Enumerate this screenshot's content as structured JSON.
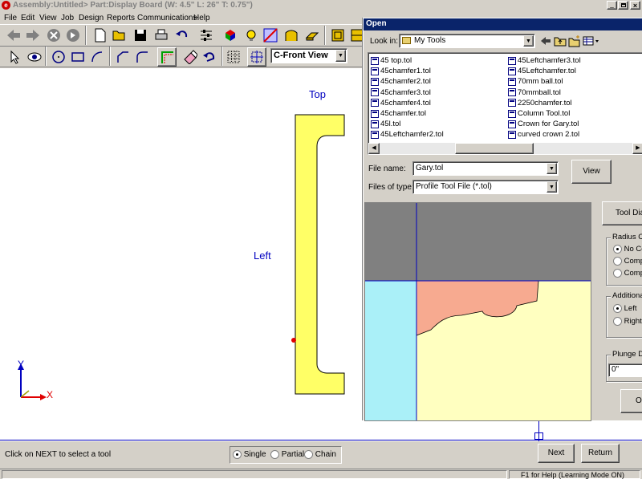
{
  "app": {
    "title": "Assembly:Untitled> Part:Display Board (W: 4.5\" L: 26\" T: 0.75\")",
    "menu": [
      "File",
      "Edit",
      "View",
      "Job",
      "Design",
      "Reports",
      "Communications",
      "Help"
    ],
    "view_select": "C-Front View"
  },
  "canvas": {
    "label_top": "Top",
    "label_left": "Left",
    "axis_y": "Y",
    "axis_x": "X"
  },
  "status": {
    "hint": "Click on NEXT to select a tool",
    "modes": [
      {
        "label": "Single",
        "checked": true
      },
      {
        "label": "Partial",
        "checked": false
      },
      {
        "label": "Chain",
        "checked": false
      }
    ],
    "next": "Next",
    "return": "Return",
    "help": "F1 for Help (Learning Mode ON)"
  },
  "dialog": {
    "title": "Open",
    "look_in_label": "Look in:",
    "look_in_value": "My Tools",
    "files_col1": [
      "45 top.tol",
      "45chamfer1.tol",
      "45chamfer2.tol",
      "45chamfer3.tol",
      "45chamfer4.tol",
      "45chamfer.tol",
      "45l.tol",
      "45Leftchamfer2.tol"
    ],
    "files_col2": [
      "45Leftchamfer3.tol",
      "45Leftchamfer.tol",
      "70mm ball.tol",
      "70mmball.tol",
      "2250chamfer.tol",
      "Column Tool.tol",
      "Crown for Gary.tol",
      "curved crown 2.tol"
    ],
    "file_name_label": "File name:",
    "file_name_value": "Gary.tol",
    "files_of_type_label": "Files of type:",
    "files_of_type_value": "Profile Tool File (*.tol)",
    "view_button": "View",
    "tool_button": "Tool Diar",
    "radius_group": "Radius Con",
    "radius_options": [
      {
        "label": "No Co",
        "checked": true
      },
      {
        "label": "Comp",
        "checked": false
      },
      {
        "label": "Comp",
        "checked": false
      }
    ],
    "additional_group": "Additional C",
    "additional_options": [
      {
        "label": "Left",
        "checked": true
      },
      {
        "label": "Right",
        "checked": false
      }
    ],
    "plunge_group": "Plunge Dep",
    "plunge_value": "0\"",
    "ok_button": "Ok"
  },
  "colors": {
    "titlebar": "#d4d0c8",
    "dialog_title": "#0a246a",
    "part_fill": "#ffff66",
    "preview_gray": "#808080",
    "preview_cyan": "#aaf0f8",
    "preview_salmon": "#f7aa90",
    "preview_cream": "#ffffc0",
    "guide_blue": "#0000c0"
  }
}
